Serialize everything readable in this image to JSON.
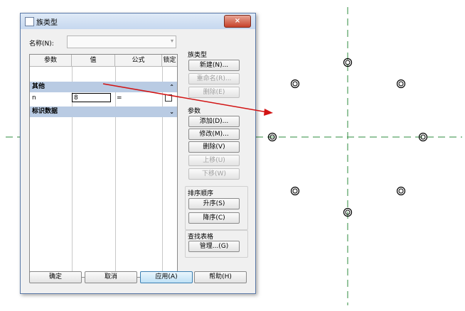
{
  "dialog": {
    "title": "族类型",
    "close_glyph": "×",
    "name_label": "名称(N):",
    "name_value": "",
    "table": {
      "headers": [
        "参数",
        "值",
        "公式",
        "锁定"
      ],
      "groups": [
        {
          "label": "其他",
          "collapse_glyph": "⌃"
        },
        {
          "label": "标识数据",
          "collapse_glyph": "⌄"
        }
      ],
      "rows": [
        {
          "param": "n",
          "value": "8",
          "formula": "=",
          "locked": false
        }
      ]
    },
    "family_types": {
      "label": "族类型",
      "new": "新建(N)...",
      "rename": "重命名(R)...",
      "delete": "删除(E)"
    },
    "parameters": {
      "label": "参数",
      "add": "添加(D)...",
      "modify": "修改(M)...",
      "remove": "删除(V)",
      "move_up": "上移(U)",
      "move_down": "下移(W)"
    },
    "sort_order": {
      "label": "排序顺序",
      "ascending": "升序(S)",
      "descending": "降序(C)"
    },
    "lookup_tables": {
      "label": "查找表格",
      "manage": "管理...(G)"
    },
    "footer": {
      "ok": "确定",
      "cancel": "取消",
      "apply": "应用(A)",
      "help": "帮助(H)"
    }
  },
  "colors": {
    "reference_line": "#2e8b3c",
    "arrow": "#d21414",
    "group_row": "#b9cbe3"
  }
}
